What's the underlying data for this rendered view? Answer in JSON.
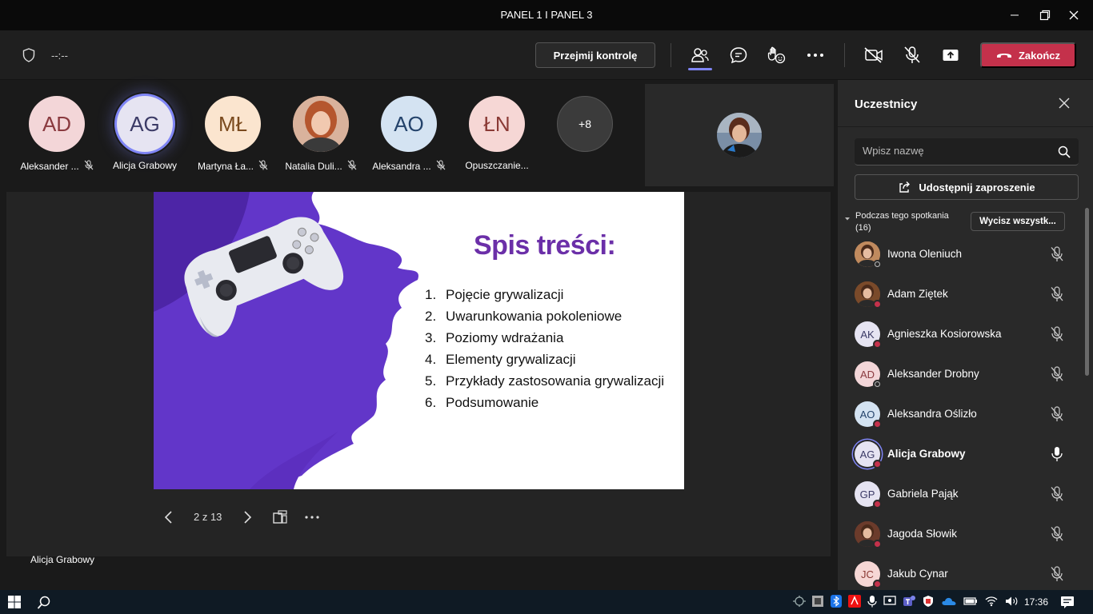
{
  "window": {
    "title": "PANEL 1 I PANEL 3",
    "controls": [
      "minimize-icon",
      "restore-icon",
      "close-icon"
    ]
  },
  "toolbar": {
    "timer": "--:--",
    "take_control_label": "Przejmij kontrolę",
    "end_label": "Zakończ",
    "icons": [
      "people-icon",
      "chat-icon",
      "reactions-icon",
      "more-icon",
      "camera-off-icon",
      "mic-off-icon",
      "share-screen-icon"
    ]
  },
  "gallery": {
    "tiles": [
      {
        "initials": "AD",
        "name": "Aleksander ...",
        "muted": true,
        "bg": "#f3d6d8",
        "fg": "#8a3a3f"
      },
      {
        "initials": "AG",
        "name": "Alicja Grabowy",
        "muted": false,
        "bg": "#e6e4f2",
        "fg": "#3b3a66",
        "active": true
      },
      {
        "initials": "MŁ",
        "name": "Martyna Ła...",
        "muted": true,
        "bg": "#fbe5cf",
        "fg": "#7a4a1e"
      },
      {
        "initials": "",
        "name": "Natalia Duli...",
        "muted": true,
        "bg": "#c88a6a",
        "fg": "#fff",
        "photo": true
      },
      {
        "initials": "AO",
        "name": "Aleksandra ...",
        "muted": true,
        "bg": "#d4e3f2",
        "fg": "#24436b"
      },
      {
        "initials": "ŁN",
        "name": "Opuszczanie...",
        "muted": false,
        "bg": "#f6d7d5",
        "fg": "#8a3a35"
      }
    ],
    "more_count": "+8"
  },
  "slide": {
    "title": "Spis treści:",
    "items": [
      {
        "num": "1.",
        "text": "Pojęcie grywalizacji"
      },
      {
        "num": "2.",
        "text": "Uwarunkowania pokoleniowe"
      },
      {
        "num": "3.",
        "text": "Poziomy wdrażania"
      },
      {
        "num": "4.",
        "text": "Elementy grywalizacji"
      },
      {
        "num": "5.",
        "text": "Przykłady zastosowania grywalizacji"
      },
      {
        "num": "6.",
        "text": "Podsumowanie"
      }
    ],
    "counter": "2 z 13",
    "presenter": "Alicja Grabowy"
  },
  "panel": {
    "title": "Uczestnicy",
    "search_placeholder": "Wpisz nazwę",
    "share_label": "Udostępnij zaproszenie",
    "section_label": "Podczas tego spotkania",
    "section_count": "(16)",
    "mute_all_label": "Wycisz wszystk...",
    "participants": [
      {
        "name": "Iwona Oleniuch",
        "initials": "",
        "bg": "#c08a5e",
        "photo": true,
        "status": "away",
        "mic": "off"
      },
      {
        "name": "Adam Ziętek",
        "initials": "",
        "bg": "#7a4a2a",
        "photo": true,
        "status": "busy",
        "mic": "off"
      },
      {
        "name": "Agnieszka Kosiorowska",
        "initials": "AK",
        "bg": "#e6e4f2",
        "fg": "#3b3a66",
        "status": "busy",
        "mic": "off"
      },
      {
        "name": "Aleksander Drobny",
        "initials": "AD",
        "bg": "#f3d6d8",
        "fg": "#8a3a3f",
        "status": "away",
        "mic": "off"
      },
      {
        "name": "Aleksandra Oślizło",
        "initials": "AO",
        "bg": "#d4e3f2",
        "fg": "#24436b",
        "status": "busy",
        "mic": "off"
      },
      {
        "name": "Alicja Grabowy",
        "initials": "AG",
        "bg": "#e6e4f2",
        "fg": "#3b3a66",
        "status": "busy",
        "mic": "on",
        "speaking": true
      },
      {
        "name": "Gabriela Pająk",
        "initials": "GP",
        "bg": "#e6e4f2",
        "fg": "#3b3a66",
        "status": "busy",
        "mic": "off"
      },
      {
        "name": "Jagoda Słowik",
        "initials": "",
        "bg": "#6b3b2b",
        "photo": true,
        "status": "busy",
        "mic": "off"
      },
      {
        "name": "Jakub Cynar",
        "initials": "JC",
        "bg": "#f6d7d5",
        "fg": "#8a3a35",
        "status": "busy",
        "mic": "off"
      }
    ]
  },
  "taskbar": {
    "clock": "17:36"
  }
}
